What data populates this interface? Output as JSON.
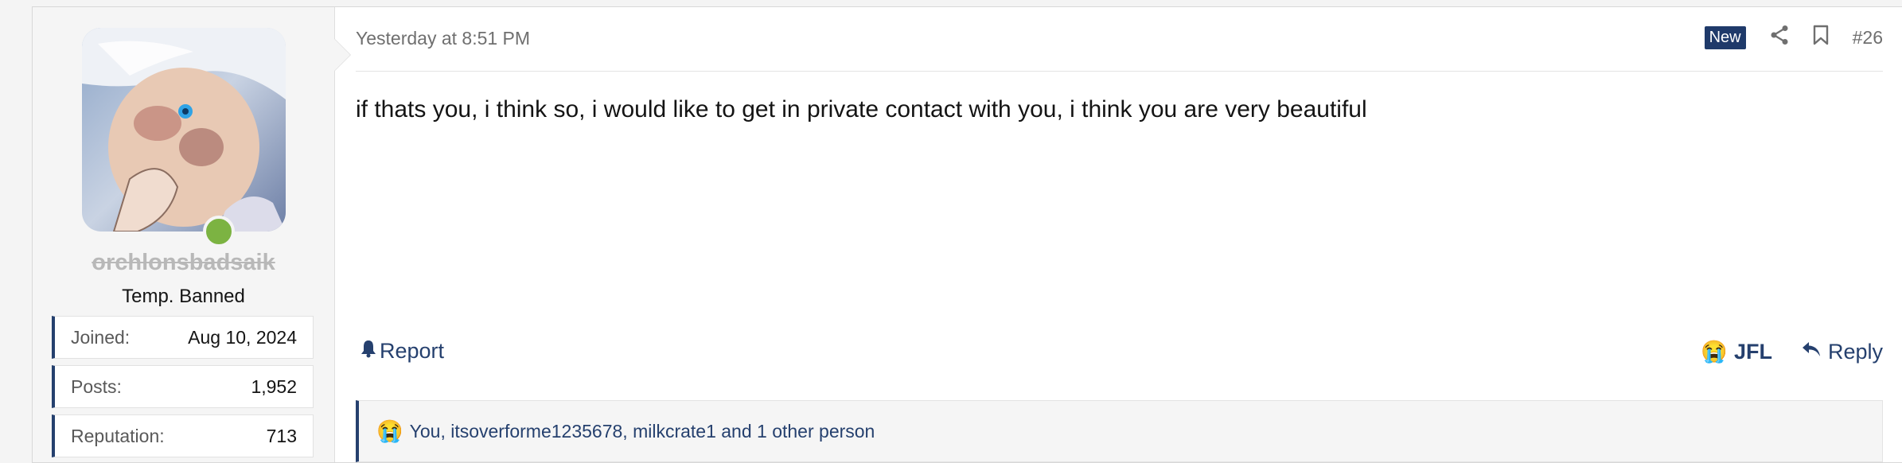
{
  "user": {
    "username": "orchlonsbadsaik",
    "title": "Temp. Banned",
    "stats": [
      {
        "label": "Joined:",
        "value": "Aug 10, 2024"
      },
      {
        "label": "Posts:",
        "value": "1,952"
      },
      {
        "label": "Reputation:",
        "value": "713"
      }
    ],
    "online": true
  },
  "post": {
    "date": "Yesterday at 8:51 PM",
    "badge": "New",
    "number": "#26",
    "message": "if thats you, i think so, i would like to get in private contact with you, i think you are very beautiful"
  },
  "actions": {
    "report": "Report",
    "jfl": "JFL",
    "reply": "Reply"
  },
  "reactions": {
    "emoji": "😭",
    "text": "You, itsoverforme1235678, milkcrate1 and 1 other person"
  },
  "colors": {
    "accent": "#25406e",
    "online": "#7cb342",
    "badge_bg": "#1f3a6a"
  }
}
